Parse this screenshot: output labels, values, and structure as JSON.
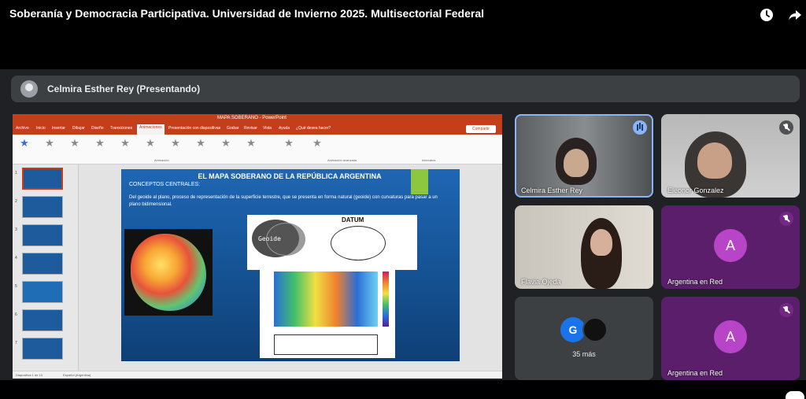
{
  "video": {
    "title": "Soberanía y Democracia Participativa. Universidad de Invierno 2025. Multisectorial Federal",
    "icons": [
      "clock-icon",
      "share-icon"
    ]
  },
  "meet": {
    "presenter_label": "Celmira Esther Rey (Presentando)"
  },
  "ppt": {
    "titlebar": "MAPA SOBERANO - PowerPoint",
    "menu": [
      "Archivo",
      "Inicio",
      "Insertar",
      "Dibujar",
      "Diseño",
      "Transiciones",
      "Animaciones",
      "Presentación con diapositivas",
      "Grabar",
      "Revisar",
      "Vista",
      "Ayuda",
      "¿Qué desea hacer?"
    ],
    "active_menu": "Animaciones",
    "share_label": "Compartir",
    "ribbon_groups": [
      "Animación",
      "Animación avanzada",
      "Intervalos"
    ],
    "status_left": "Diapositiva 1 de 13",
    "status_mid": "Español (Argentina)"
  },
  "slide": {
    "title": "EL MAPA SOBERANO DE LA REPÚBLICA ARGENTINA",
    "subtitle": "CONCEPTOS CENTRALES:",
    "bullet": "Del geoide al plano, proceso de representación de la superficie terrestre, que se presenta en forma natural (geoide) con curvaturas para pasar a un plano bidimensional.",
    "geoide_label": "Geoide",
    "datum_label": "DATUM"
  },
  "participants": [
    {
      "name": "Celmira Esther Rey",
      "type": "camera",
      "state": "speaking"
    },
    {
      "name": "Eleonor Gonzalez",
      "type": "camera",
      "state": "muted"
    },
    {
      "name": "Flavia Ojeda",
      "type": "camera",
      "state": "none"
    },
    {
      "name": "Argentina en Red",
      "type": "avatar",
      "letter": "A",
      "state": "muted"
    },
    {
      "name": "Argentina en Red",
      "type": "avatar",
      "letter": "A",
      "state": "muted"
    }
  ],
  "more": {
    "letter": "G",
    "label": "35 más"
  }
}
